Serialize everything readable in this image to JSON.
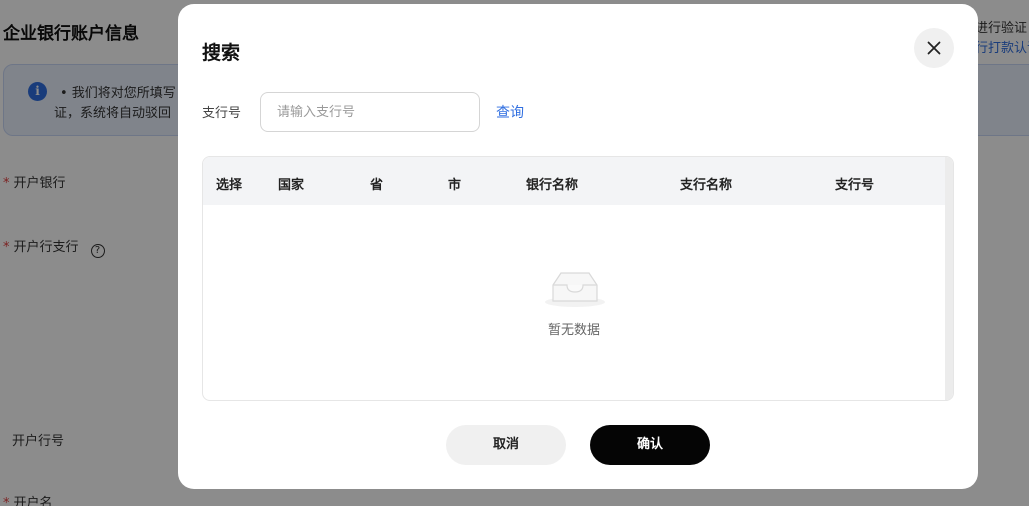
{
  "background": {
    "page_title": "企业银行账户信息",
    "notice": {
      "line1": "• 我们将对您所填写",
      "line2": "证，系统将自动驳回",
      "right1": "进行验证",
      "right2": "行打款认证"
    },
    "fields": {
      "bank": "开户银行",
      "branch": "开户行支行",
      "branch_no": "开户行号",
      "account_name": "开户名"
    }
  },
  "modal": {
    "title": "搜索",
    "search": {
      "label": "支行号",
      "placeholder": "请输入支行号",
      "value": "",
      "query_label": "查询"
    },
    "table": {
      "columns": [
        "选择",
        "国家",
        "省",
        "市",
        "银行名称",
        "支行名称",
        "支行号"
      ],
      "rows": [],
      "empty_text": "暂无数据"
    },
    "buttons": {
      "cancel": "取消",
      "confirm": "确认"
    }
  },
  "colors": {
    "accent": "#2f6ee0",
    "required": "#e23d3d",
    "confirm_bg": "#050505"
  }
}
